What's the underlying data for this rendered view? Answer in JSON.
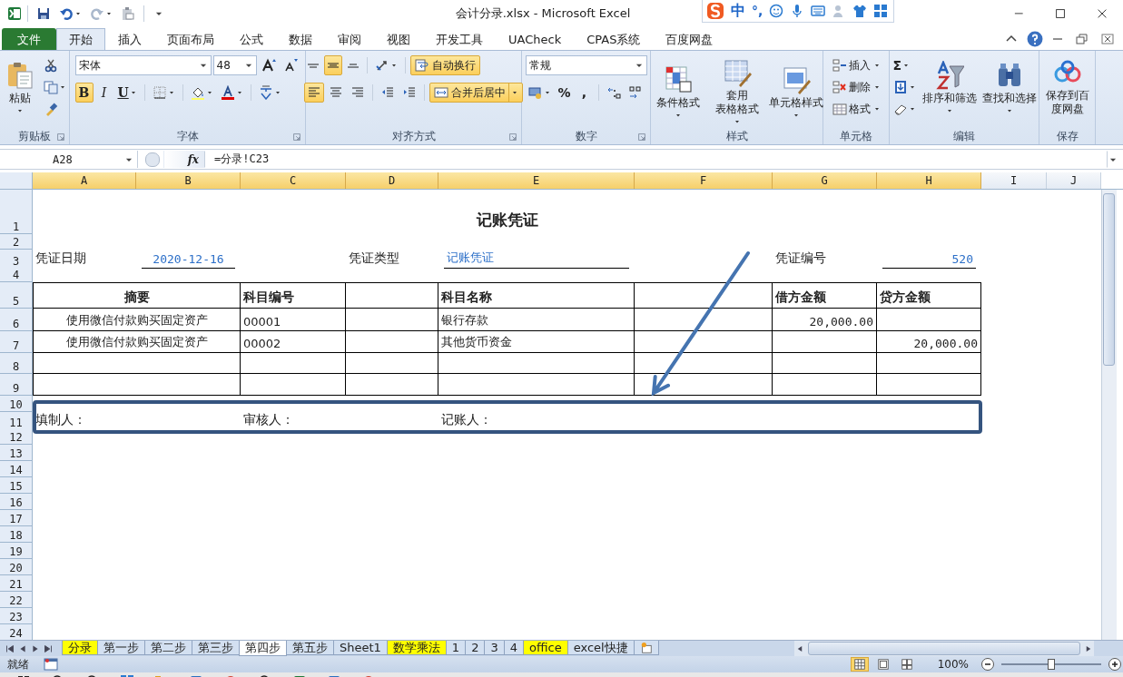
{
  "window": {
    "title": "会计分录.xlsx  -  Microsoft Excel"
  },
  "ime_bar": {
    "mode": "中",
    "punctuation": "°,"
  },
  "ribbon_tabs": [
    {
      "label": "文件",
      "kind": "file",
      "selected": false
    },
    {
      "label": "开始",
      "kind": "tab",
      "selected": true
    },
    {
      "label": "插入",
      "kind": "tab",
      "selected": false
    },
    {
      "label": "页面布局",
      "kind": "tab",
      "selected": false
    },
    {
      "label": "公式",
      "kind": "tab",
      "selected": false
    },
    {
      "label": "数据",
      "kind": "tab",
      "selected": false
    },
    {
      "label": "审阅",
      "kind": "tab",
      "selected": false
    },
    {
      "label": "视图",
      "kind": "tab",
      "selected": false
    },
    {
      "label": "开发工具",
      "kind": "tab",
      "selected": false
    },
    {
      "label": "UACheck",
      "kind": "tab",
      "selected": false
    },
    {
      "label": "CPAS系统",
      "kind": "tab",
      "selected": false
    },
    {
      "label": "百度网盘",
      "kind": "tab",
      "selected": false
    }
  ],
  "ribbon_groups": [
    {
      "title": "剪贴板",
      "items": [
        {
          "kind": "large",
          "label": "粘贴"
        }
      ]
    },
    {
      "title": "字体",
      "items": [
        {
          "kind": "combo",
          "value": "宋体"
        },
        {
          "kind": "combo",
          "value": "48"
        },
        {
          "kind": "toggle",
          "label": "B",
          "selected": true
        },
        {
          "kind": "toggle",
          "label": "I",
          "selected": false
        },
        {
          "kind": "toggle",
          "label": "U",
          "selected": false
        }
      ]
    },
    {
      "title": "对齐方式",
      "items": [
        {
          "kind": "toggle",
          "selected": false
        },
        {
          "kind": "toggle",
          "selected": true
        },
        {
          "kind": "toggle",
          "selected": false
        },
        {
          "kind": "wide",
          "label": "自动换行",
          "selected": true
        },
        {
          "kind": "toggle",
          "selected": true
        },
        {
          "kind": "toggle",
          "selected": false
        },
        {
          "kind": "toggle",
          "selected": false
        },
        {
          "kind": "wide",
          "label": "合并后居中",
          "selected": true
        }
      ]
    },
    {
      "title": "数字",
      "items": [
        {
          "kind": "combo",
          "value": "常规"
        },
        {
          "kind": "symbol",
          "label": "%"
        },
        {
          "kind": "symbol",
          "label": ","
        }
      ]
    },
    {
      "title": "样式",
      "items": [
        {
          "kind": "large",
          "label": "条件格式"
        },
        {
          "kind": "large",
          "lines": [
            "套用",
            "表格格式"
          ]
        },
        {
          "kind": "large",
          "label": "单元格样式"
        }
      ]
    },
    {
      "title": "单元格",
      "items": [
        {
          "kind": "small",
          "label": "插入"
        },
        {
          "kind": "small",
          "label": "删除"
        },
        {
          "kind": "small",
          "label": "格式"
        }
      ]
    },
    {
      "title": "编辑",
      "items": [
        {
          "kind": "symbol",
          "label": "Σ"
        },
        {
          "kind": "large",
          "label": "排序和筛选"
        },
        {
          "kind": "large",
          "label": "查找和选择"
        }
      ]
    },
    {
      "title": "保存",
      "items": [
        {
          "kind": "large",
          "lines": [
            "保存到百",
            "度网盘"
          ]
        }
      ]
    }
  ],
  "formula_bar": {
    "cell": "A28",
    "fx": "fx",
    "formula": "=分录!C23"
  },
  "columns": [
    {
      "label": "A",
      "selected": true
    },
    {
      "label": "B",
      "selected": true
    },
    {
      "label": "C",
      "selected": true
    },
    {
      "label": "D",
      "selected": true
    },
    {
      "label": "E",
      "selected": true
    },
    {
      "label": "F",
      "selected": true
    },
    {
      "label": "G",
      "selected": true
    },
    {
      "label": "H",
      "selected": true
    },
    {
      "label": "I",
      "selected": false
    },
    {
      "label": "J",
      "selected": false
    }
  ],
  "rows": [
    {
      "number": "1",
      "cells": [
        {
          "kind": "title",
          "text": "记账凭证"
        }
      ]
    },
    {
      "number": "2"
    },
    {
      "number": "3",
      "cells": [
        {
          "kind": "label",
          "text": "凭证日期"
        },
        {
          "kind": "field",
          "text": "2020-12-16"
        },
        null,
        {
          "kind": "label",
          "text": "凭证类型"
        },
        {
          "kind": "field",
          "text": "记账凭证"
        },
        null,
        {
          "kind": "label",
          "text": "凭证编号"
        },
        {
          "kind": "field",
          "text": "520"
        }
      ]
    },
    {
      "number": "4"
    },
    {
      "number": "5",
      "cells": [
        {
          "kind": "header",
          "text": "摘要"
        },
        {
          "kind": "header",
          "text": "科目编号"
        },
        {
          "kind": "blank"
        },
        {
          "kind": "header",
          "text": "科目名称"
        },
        {
          "kind": "blank"
        },
        {
          "kind": "header",
          "text": "借方金额"
        },
        {
          "kind": "header",
          "text": "贷方金额"
        }
      ]
    },
    {
      "number": "6",
      "cells": [
        {
          "kind": "text",
          "text": "使用微信付款购买固定资产"
        },
        {
          "kind": "text",
          "text": "00001"
        },
        {
          "kind": "blank"
        },
        {
          "kind": "text",
          "text": "银行存款"
        },
        {
          "kind": "blank"
        },
        {
          "kind": "amount",
          "text": "20,000.00"
        },
        {
          "kind": "blank"
        }
      ]
    },
    {
      "number": "7",
      "cells": [
        {
          "kind": "text",
          "text": "使用微信付款购买固定资产"
        },
        {
          "kind": "text",
          "text": "00002"
        },
        {
          "kind": "blank"
        },
        {
          "kind": "text",
          "text": "其他货币资金"
        },
        {
          "kind": "blank"
        },
        {
          "kind": "blank"
        },
        {
          "kind": "amount",
          "text": "20,000.00"
        }
      ]
    },
    {
      "number": "8",
      "cells": [
        {
          "kind": "blank"
        },
        {
          "kind": "blank"
        },
        {
          "kind": "blank"
        },
        {
          "kind": "blank"
        },
        {
          "kind": "blank"
        },
        {
          "kind": "blank"
        },
        {
          "kind": "blank"
        }
      ]
    },
    {
      "number": "9",
      "cells": [
        {
          "kind": "blank"
        },
        {
          "kind": "blank"
        },
        {
          "kind": "blank"
        },
        {
          "kind": "blank"
        },
        {
          "kind": "blank"
        },
        {
          "kind": "blank"
        },
        {
          "kind": "blank"
        }
      ]
    },
    {
      "number": "10"
    },
    {
      "number": "11",
      "cells": [
        {
          "kind": "label",
          "text": "填制人："
        },
        null,
        {
          "kind": "label",
          "text": "审核人："
        },
        null,
        {
          "kind": "label",
          "text": "记账人："
        }
      ]
    },
    {
      "number": "12"
    },
    {
      "number": "13"
    },
    {
      "number": "14"
    },
    {
      "number": "15"
    },
    {
      "number": "16"
    },
    {
      "number": "17"
    },
    {
      "number": "18"
    },
    {
      "number": "19"
    },
    {
      "number": "20"
    },
    {
      "number": "21"
    },
    {
      "number": "22"
    },
    {
      "number": "23"
    },
    {
      "number": "24"
    }
  ],
  "sheet_tabs": [
    {
      "label": "分录",
      "color": "#ffff00",
      "selected": false
    },
    {
      "label": "第一步",
      "color": "#d3e0f1",
      "selected": false
    },
    {
      "label": "第二步",
      "color": "#d3e0f1",
      "selected": false
    },
    {
      "label": "第三步",
      "color": "#d3e0f1",
      "selected": false
    },
    {
      "label": "第四步",
      "color": "#ffffff",
      "selected": true
    },
    {
      "label": "第五步",
      "color": "#d3e0f1",
      "selected": false
    },
    {
      "label": "Sheet1",
      "color": "#d3e0f1",
      "selected": false
    },
    {
      "label": "数学乘法",
      "color": "#ffff00",
      "selected": false
    },
    {
      "label": "1",
      "color": "#d3e0f1",
      "selected": false
    },
    {
      "label": "2",
      "color": "#d3e0f1",
      "selected": false
    },
    {
      "label": "3",
      "color": "#d3e0f1",
      "selected": false
    },
    {
      "label": "4",
      "color": "#d3e0f1",
      "selected": false
    },
    {
      "label": "office",
      "color": "#ffff00",
      "selected": false
    },
    {
      "label": "excel快捷",
      "color": "#d3e0f1",
      "selected": false
    }
  ],
  "status_bar": {
    "text": "就绪",
    "views": [
      {
        "selected": true
      },
      {
        "selected": false
      },
      {
        "selected": false
      }
    ],
    "zoom": "100%",
    "zoom_slider": {
      "level": 0.5
    }
  }
}
